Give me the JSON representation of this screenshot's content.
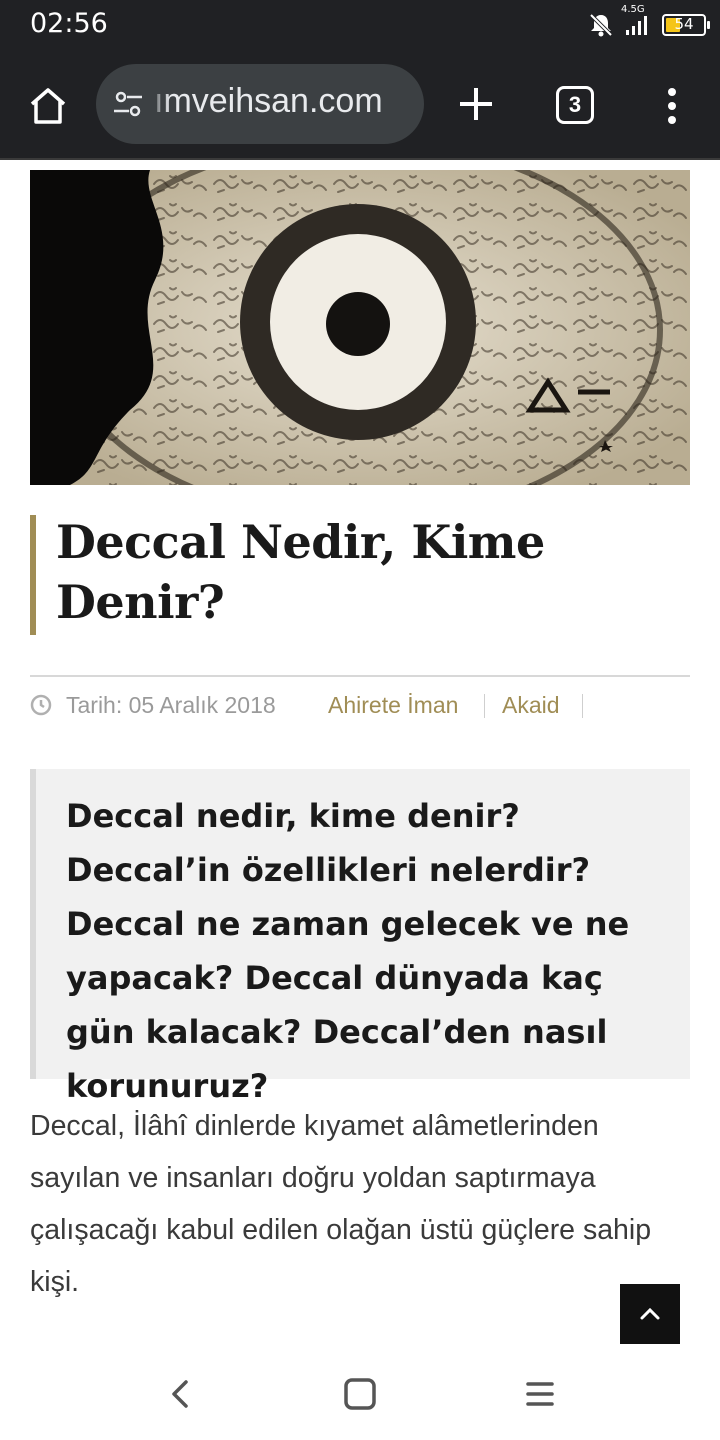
{
  "status_bar": {
    "time": "02:56",
    "network": "4.5G",
    "battery": "54",
    "icons": [
      "bell-off-icon",
      "signal-icon",
      "battery-icon"
    ]
  },
  "browser": {
    "url": "ımveihsan.com",
    "tab_count": "3",
    "icons": [
      "home-icon",
      "site-settings-icon",
      "new-tab-icon",
      "tabs-icon",
      "menu-icon"
    ]
  },
  "article": {
    "hero_image": "eye-illustration",
    "title": "Deccal Nedir, Kime Denir?",
    "date": "Tarih: 05 Aralık 2018",
    "categories": [
      "Ahirete İman",
      "Akaid"
    ],
    "quote": "Deccal nedir, kime denir? Deccal’in özellikleri nelerdir? Deccal ne zaman gelecek ve ne yapacak? Deccal dünyada kaç gün kalacak? Deccal’den nasıl korunuruz?",
    "body": "Deccal, İlâhî dinlerde kıyamet alâmetlerinden sayılan ve insanları doğru yoldan saptırmaya çalışacağı kabul edilen olağan üstü güçlere sahip kişi."
  },
  "colors": {
    "accent": "#a08d55",
    "toolbar": "#202124",
    "url_pill": "#3c4043",
    "quote_bg": "#f1f1f1"
  }
}
